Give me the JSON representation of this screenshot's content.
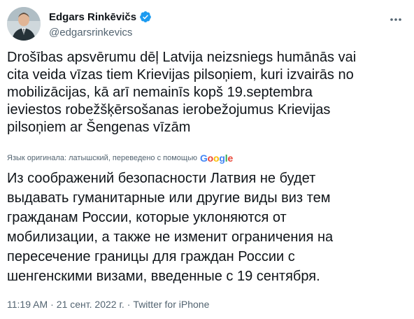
{
  "author": {
    "display_name": "Edgars Rinkēvičs",
    "handle": "@edgarsrinkevics",
    "verified": true,
    "avatar": "portrait-photo"
  },
  "tweet": {
    "original_text": "Drošības apsvērumu dēļ Latvija neizsniegs humānās vai\ncita veida vīzas tiem Krievijas pilsoņiem, kuri izvairās no\nmobilizācijas, kā arī nemainīs kopš 19.septembra\nieviestos robežšķērsošanas ierobežojumus Krievijas\npilsoņiem ar Šengenas vīzām",
    "translation_note": "Язык оригинала: латышский, переведено с помощью",
    "translation_provider": {
      "G": "G",
      "o1": "o",
      "o2": "o",
      "g": "g",
      "l": "l",
      "e": "e"
    },
    "translated_text": "Из соображений безопасности Латвия не будет\nвыдавать гуманитарные или другие виды виз тем\nгражданам России, которые уклоняются от\nмобилизации, а также не изменит ограничения на\nпересечение границы для граждан России с\nшенгенскими визами, введенные с 19 сентября.",
    "time": "11:19 AM",
    "separator": "·",
    "date": "21 сент. 2022 г.",
    "source": "Twitter for iPhone"
  },
  "colors": {
    "text": "#0f1419",
    "secondary": "#536471",
    "verified": "#1d9bf0",
    "google_blue": "#4285f4",
    "google_red": "#ea4335",
    "google_yellow": "#fbbc05",
    "google_green": "#34a853"
  },
  "icons": {
    "verified": "verified-badge-icon",
    "more": "more-dots-icon"
  }
}
